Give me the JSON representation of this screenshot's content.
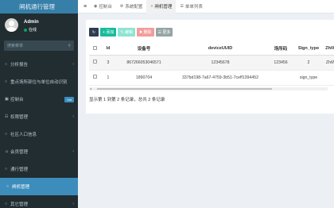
{
  "app": {
    "title": "闸机通行管理"
  },
  "user": {
    "name": "Admin",
    "status": "在线"
  },
  "search": {
    "placeholder": "搜索菜单",
    "icon": "search-icon"
  },
  "sidebar": {
    "items": [
      {
        "label": "分析报告",
        "icon": "circle-icon",
        "has_caret": true
      },
      {
        "label": "重点场所部位与单位自动识别",
        "icon": "circle-icon",
        "has_caret": false
      },
      {
        "label": "控制台",
        "icon": "dashboard-icon",
        "badge": "hot"
      },
      {
        "label": "权限管理",
        "icon": "group-icon",
        "has_caret": true
      },
      {
        "label": "社区人口信息",
        "icon": "circle-icon",
        "has_caret": false
      },
      {
        "label": "会员管理",
        "icon": "user-icon",
        "has_caret": true
      },
      {
        "label": "通行管理",
        "icon": "circle-icon",
        "has_caret": false
      },
      {
        "label": "闸机管理",
        "icon": "circle-icon",
        "active": true
      },
      {
        "label": "其它管理",
        "icon": "circle-icon",
        "has_caret": true
      }
    ]
  },
  "topbar": {
    "menu_icon": "≡",
    "tabs": [
      {
        "label": "控制台",
        "icon": "dashboard-icon"
      },
      {
        "label": "系统配置",
        "icon": "gear-icon"
      },
      {
        "label": "闸机管理",
        "icon": "circle-icon",
        "active": true
      },
      {
        "label": "单单列表",
        "icon": "list-icon"
      }
    ]
  },
  "toolbar": {
    "refresh_label": "↻",
    "add_label": "+ 添加",
    "edit_label": "✎ 编辑",
    "delete_label": "✖ 删除",
    "more_label": "☰ 更多"
  },
  "table": {
    "columns": [
      "",
      "Id",
      "设备号",
      "deviceUUID",
      "场所码",
      "Sign_type",
      "ZhiW..."
    ],
    "rows": [
      {
        "id": "3",
        "device_no": "867266053046571",
        "uuid": "12345678",
        "place_code": "123456",
        "sign_type": "2",
        "extra": "ZhiW..."
      },
      {
        "id": "1",
        "device_no": "1890704",
        "uuid": "337bd198-7a67-4759-3b51-7ceff1394452",
        "place_code": "",
        "sign_type": "sign_type",
        "extra": ""
      }
    ]
  },
  "pagination": {
    "info": "显示第 1 到第 2 条记录，总共 2 条记录"
  },
  "colors": {
    "sidebar": "#222d32",
    "brand": "#367fa9",
    "active": "#3c8dbc",
    "add": "#18bc9c"
  }
}
